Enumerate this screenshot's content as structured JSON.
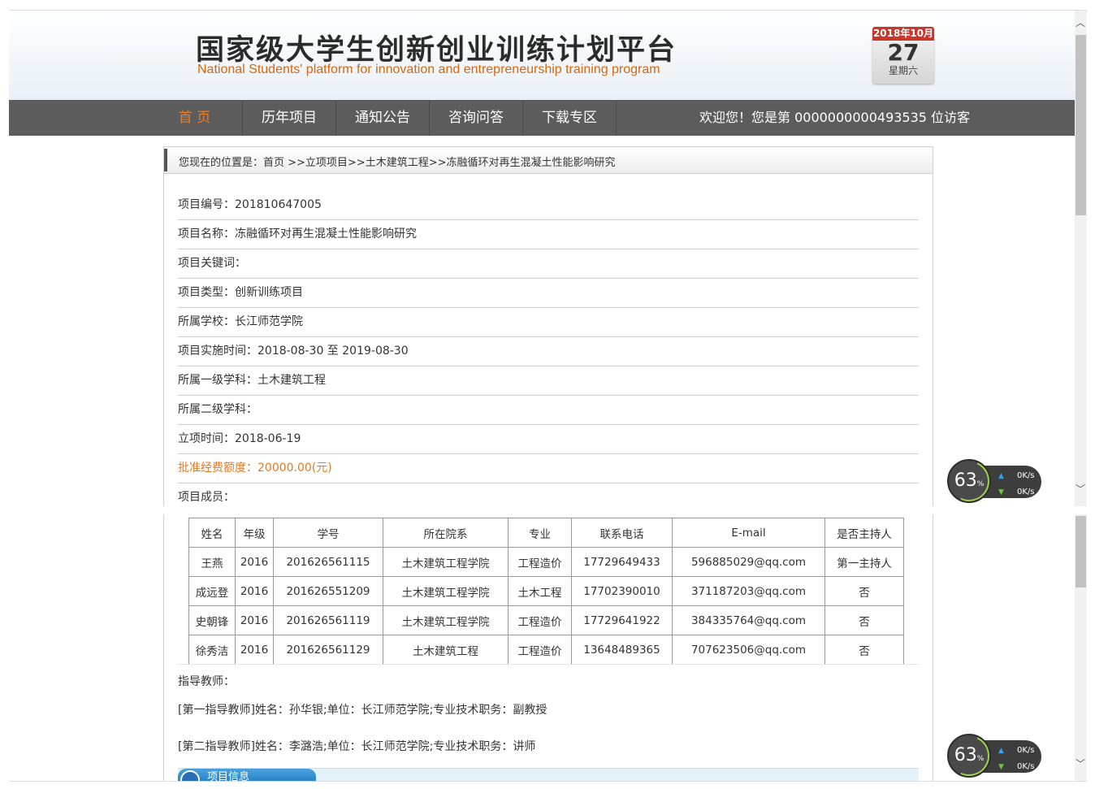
{
  "header": {
    "title_zh": "国家级大学生创新创业训练计划平台",
    "title_en": "National Students' platform for innovation and entrepreneurship training program",
    "calendar": {
      "month": "2018年10月",
      "day": "27",
      "weekday": "星期六"
    }
  },
  "nav": {
    "items": [
      "首 页",
      "历年项目",
      "通知公告",
      "咨询问答",
      "下载专区"
    ],
    "welcome": "欢迎您！您是第 0000000000493535 位访客"
  },
  "breadcrumb": "您现在的位置是：首页 >>立项项目>>土木建筑工程>>冻融循环对再生混凝土性能影响研究",
  "fields": {
    "project_no": "项目编号：201810647005",
    "project_name": "项目名称：冻融循环对再生混凝土性能影响研究",
    "keywords": "项目关键词：",
    "type": "项目类型：创新训练项目",
    "school": "所属学校：长江师范学院",
    "period": "项目实施时间：2018-08-30 至 2019-08-30",
    "subject1": "所属一级学科：土木建筑工程",
    "subject2": "所属二级学科：",
    "approved_date": "立项时间：2018-06-19",
    "funding": "批准经费额度：20000.00(元)",
    "members_label": "项目成员："
  },
  "members": {
    "headers": [
      "姓名",
      "年级",
      "学号",
      "所在院系",
      "专业",
      "联系电话",
      "E-mail",
      "是否主持人"
    ],
    "rows": [
      [
        "王燕",
        "2016",
        "201626561115",
        "土木建筑工程学院",
        "工程造价",
        "17729649433",
        "596885029@qq.com",
        "第一主持人"
      ],
      [
        "成远登",
        "2016",
        "201626551209",
        "土木建筑工程学院",
        "土木工程",
        "17702390010",
        "371187203@qq.com",
        "否"
      ],
      [
        "史朝锋",
        "2016",
        "201626561119",
        "土木建筑工程学院",
        "工程造价",
        "17729641922",
        "384335764@qq.com",
        "否"
      ],
      [
        "徐秀洁",
        "2016",
        "201626561129",
        "土木建筑工程",
        "工程造价",
        "13648489365",
        "707623506@qq.com",
        "否"
      ]
    ]
  },
  "advisors": {
    "label": "指导教师：",
    "first": "[第一指导教师]姓名：孙华银;单位：长江师范学院;专业技术职务：副教授",
    "second": "[第二指导教师]姓名：李潞浩;单位：长江师范学院;专业技术职务：讲师"
  },
  "section_tab": "项目信息",
  "widget": {
    "percent": "63",
    "unit": "%",
    "up": "0K/s",
    "down": "0K/s"
  },
  "colors": {
    "nav_bg": "#5c5c5c",
    "active_nav": "#ef7d22",
    "funding": "#e47a25",
    "title_en": "#d8660f"
  }
}
